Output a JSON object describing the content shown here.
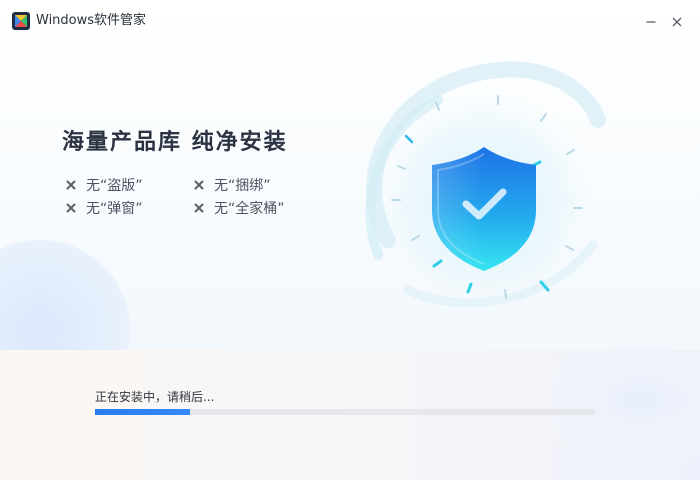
{
  "window": {
    "title": "Windows软件管家",
    "minimize_icon": "minimize-icon",
    "close_icon": "close-icon"
  },
  "hero": {
    "headline": "海量产品库 纯净安装",
    "features": [
      "无“盗版”",
      "无“捆绑”",
      "无“弹窗”",
      "无“全家桶”"
    ],
    "feature_icon": "cross-icon",
    "illustration_icon": "shield-check-icon"
  },
  "install": {
    "status_text": "正在安装中，请稍后...",
    "progress": 0.19
  },
  "colors": {
    "accent": "#2a7cf1",
    "track": "#e5e7eb",
    "shield_top": "#1f78e8",
    "shield_bottom": "#2fe3f0"
  }
}
